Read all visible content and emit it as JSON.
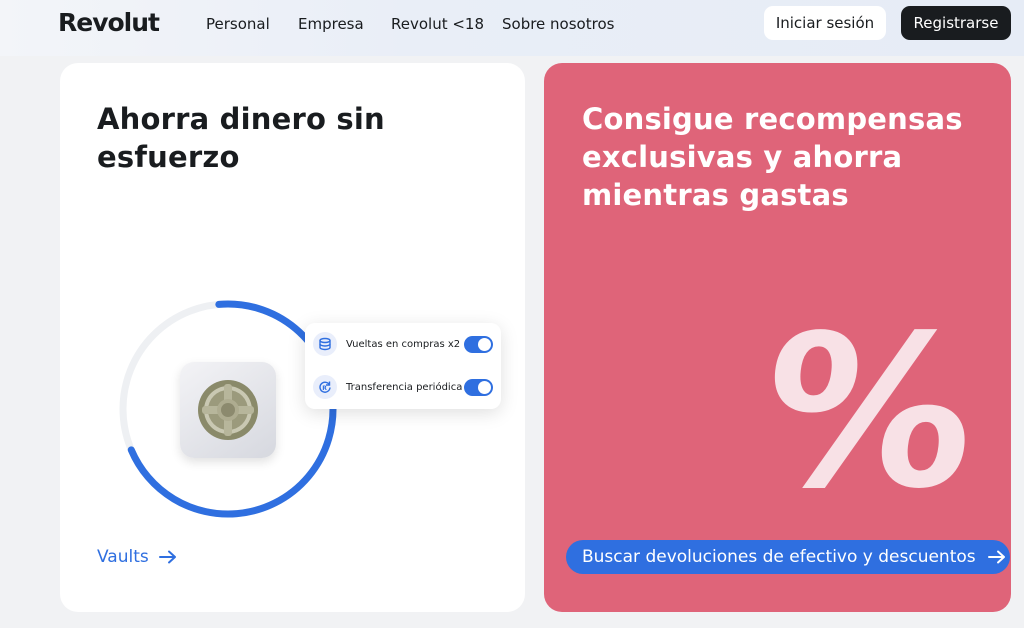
{
  "header": {
    "logo": "Revolut",
    "nav": [
      "Personal",
      "Empresa",
      "Revolut <18",
      "Sobre nosotros"
    ],
    "login_label": "Iniciar sesión",
    "register_label": "Registrarse"
  },
  "card_savings": {
    "title": "Ahorra dinero sin esfuerzo",
    "popup": [
      {
        "label": "Vueltas en compras x2",
        "icon": "coins-icon",
        "toggle_on": true
      },
      {
        "label": "Transferencia periódica",
        "icon": "recurring-icon",
        "toggle_on": true
      }
    ],
    "link_label": "Vaults",
    "progress_ring_fraction": 0.7
  },
  "card_rewards": {
    "title": "Consigue recompensas exclusivas y ahorra mientras gastas",
    "symbol": "%",
    "button_label": "Buscar devoluciones de efectivo y descuentos"
  },
  "colors": {
    "accent_blue": "#2f6fe0",
    "rewards_bg": "#df6479",
    "dark": "#191c1f"
  }
}
